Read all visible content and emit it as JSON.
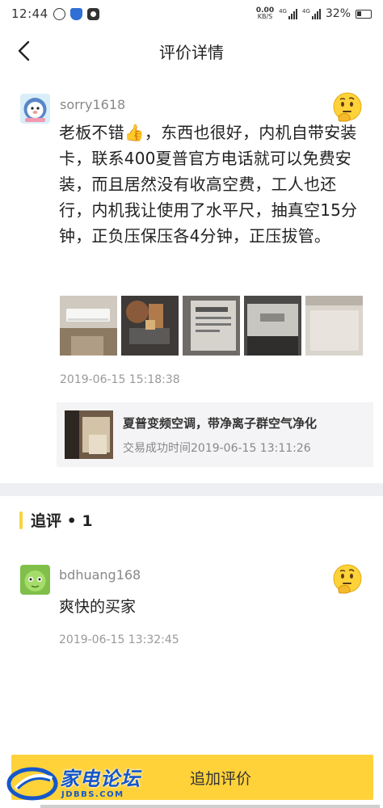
{
  "status_bar": {
    "time": "12:44",
    "net_speed_value": "0.00",
    "net_speed_unit": "KB/S",
    "signal1_tag": "4G",
    "signal2_tag": "4G",
    "battery": "32%"
  },
  "header": {
    "title": "评价详情",
    "back_icon": "chevron-left-icon"
  },
  "review": {
    "username": "sorry1618",
    "text": "老板不错👍，东西也很好，内机自带安装卡，联系400夏普官方电话就可以免费安装，而且居然没有收高空费，工人也还行，内机我让使用了水平尺，抽真空15分钟，正负压保压各4分钟，正压拔管。",
    "time": "2019-06-15 15:18:38",
    "emoji_icon": "thinking-face-icon",
    "photo_count": 5
  },
  "product": {
    "name": "夏普变频空调，带净离子群空气净化",
    "time": "交易成功时间2019-06-15 13:11:26"
  },
  "followup": {
    "title": "追评 • 1",
    "username": "bdhuang168",
    "text": "爽快的买家",
    "time": "2019-06-15 13:32:45",
    "emoji_icon": "thinking-face-icon"
  },
  "bottom": {
    "button_label": "追加评价"
  },
  "watermark": {
    "name": "家电论坛",
    "site": "JDBBS.COM"
  },
  "colors": {
    "accent": "#ffd23a",
    "watermark_blue": "#1557c9"
  }
}
